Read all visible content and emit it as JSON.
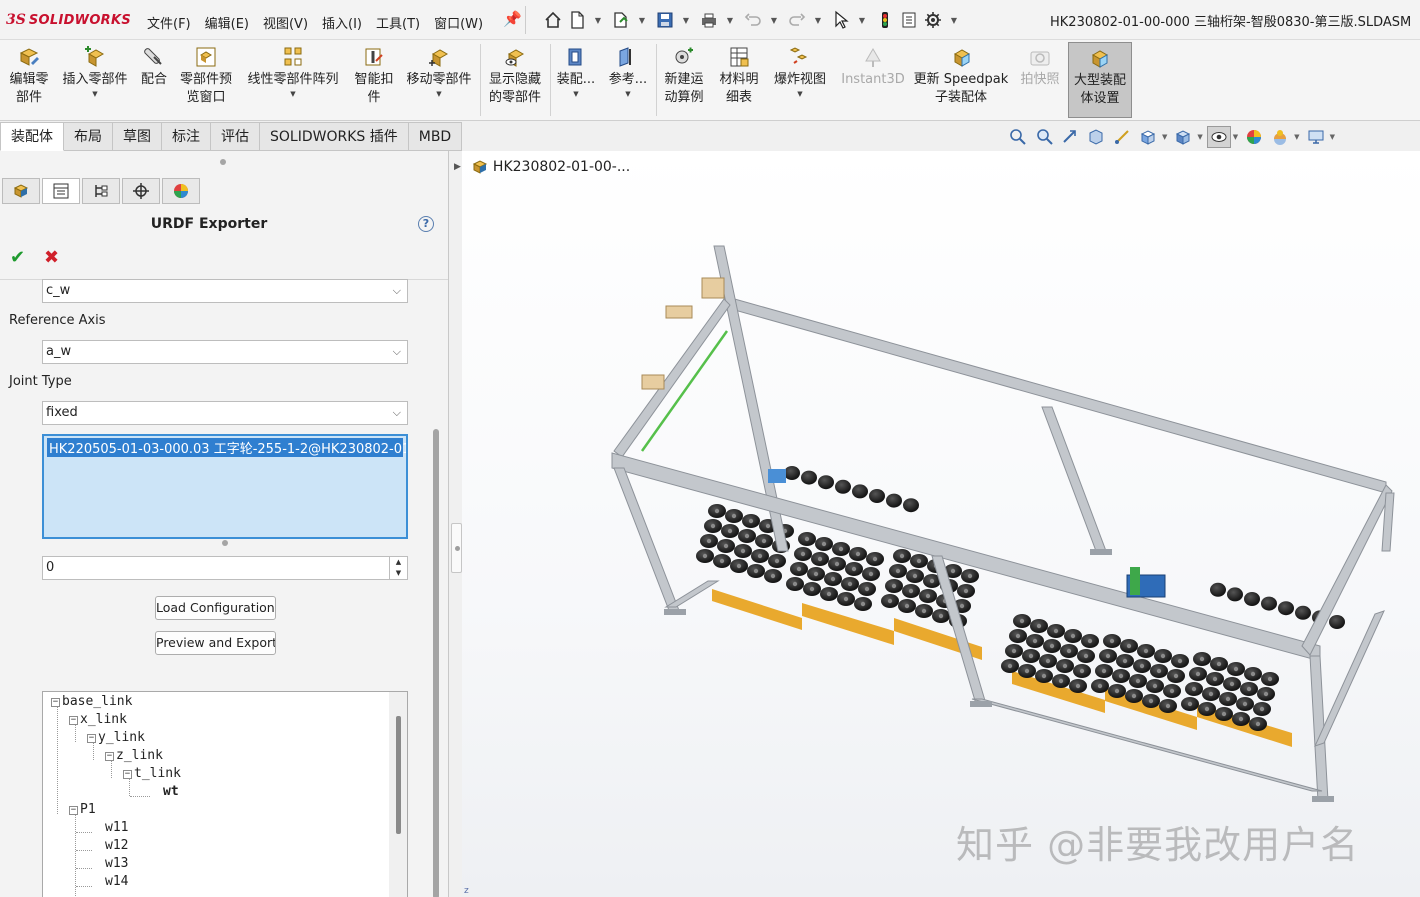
{
  "app": {
    "brand_prefix": "3S",
    "brand_name": "SOLIDWORKS",
    "document_title": "HK230802-01-00-000 三轴桁架-智殷0830-第三版.SLDASM"
  },
  "menu": [
    "文件(F)",
    "编辑(E)",
    "视图(V)",
    "插入(I)",
    "工具(T)",
    "窗口(W)"
  ],
  "quick_access": [
    "home-icon",
    "new-document-icon",
    "open-icon",
    "save-icon",
    "print-icon",
    "undo-icon",
    "redo-icon",
    "select-icon",
    "rebuild-icon",
    "file-properties-icon",
    "options-icon"
  ],
  "command_manager": {
    "edit_component": "编辑零\n部件",
    "insert_components": "插入零部件",
    "mate": "配合",
    "component_preview": "零部件预\n览窗口",
    "linear_pattern": "线性零部件阵列",
    "smart_fasteners": "智能扣\n件",
    "move_component": "移动零部件",
    "show_hidden": "显示隐藏\n的零部件",
    "assembly_features": "装配...",
    "reference_geometry": "参考...",
    "new_motion_study": "新建运\n动算例",
    "bill_of_materials": "材料明\n细表",
    "exploded_view": "爆炸视图",
    "instant3d": "Instant3D",
    "update_speedpak": "更新 Speedpak\n子装配体",
    "snapshot": "拍快照",
    "large_assembly": "大型装配\n体设置"
  },
  "tabs": [
    "装配体",
    "布局",
    "草图",
    "标注",
    "评估",
    "SOLIDWORKS 插件",
    "MBD"
  ],
  "property_manager": {
    "title": "URDF Exporter",
    "help": "?",
    "ok": "✔",
    "cancel": "✖",
    "axis_value": "c_w",
    "reference_axis_label": "Reference Axis",
    "reference_axis_value": "a_w",
    "joint_type_label": "Joint Type",
    "joint_type_value": "fixed",
    "selected_components": "HK220505-01-03-000.03 工字轮-255-1-2@HK230802-01-00-0",
    "numeric_value": "0",
    "load_button": "Load Configuration..",
    "preview_button": "Preview and Export.."
  },
  "link_tree": [
    {
      "label": "base_link",
      "level": 0,
      "expandable": true
    },
    {
      "label": "x_link",
      "level": 1,
      "expandable": true
    },
    {
      "label": "y_link",
      "level": 2,
      "expandable": true
    },
    {
      "label": "z_link",
      "level": 3,
      "expandable": true
    },
    {
      "label": "t_link",
      "level": 4,
      "expandable": true
    },
    {
      "label": "wt",
      "level": 5,
      "expandable": false
    },
    {
      "label": "P1",
      "level": 1,
      "expandable": true
    },
    {
      "label": "w11",
      "level": 2,
      "expandable": false
    },
    {
      "label": "w12",
      "level": 2,
      "expandable": false
    },
    {
      "label": "w13",
      "level": 2,
      "expandable": false
    },
    {
      "label": "w14",
      "level": 2,
      "expandable": false
    }
  ],
  "viewport": {
    "feature_tree_root": "HK230802-01-00-...",
    "watermark": "知乎 @非要我改用户名"
  },
  "colors": {
    "brand_red": "#c8102e",
    "selection_fill": "#cce4f7",
    "selection_border": "#3c8fd6",
    "frame_gray": "#b8bcc2",
    "pallet_orange": "#f0b43c",
    "spool_black": "#2a2a2a"
  }
}
